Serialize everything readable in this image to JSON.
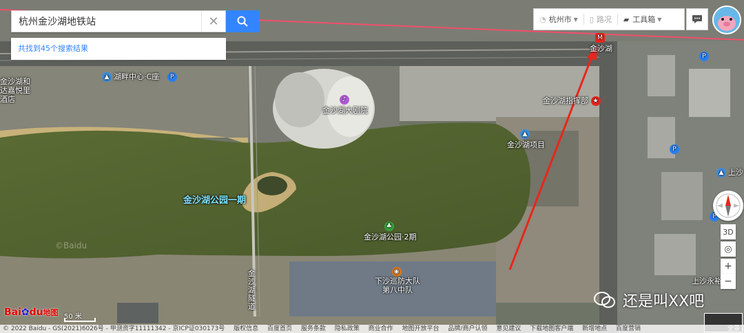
{
  "search": {
    "query": "杭州金沙湖地铁站",
    "result_prefix": "共找到",
    "result_count": "45",
    "result_suffix": "个搜索结果"
  },
  "toolbar": {
    "city": "杭州市",
    "traffic": "路况",
    "tools": "工具箱"
  },
  "controls": {
    "three_d": "3D",
    "zoom_in": "+",
    "zoom_out": "−",
    "panorama": "全景"
  },
  "pois": {
    "metro_station": "金沙湖",
    "theater": "金沙湖大剧院",
    "lakeside_center": "湖畔中心·C座",
    "hotel": "金沙湖和达嘉悦里酒店",
    "hq": "金沙湖指挥部",
    "project": "金沙湖项目",
    "park_phase1": "金沙湖公园一期",
    "park_phase2": "金沙湖公园·2期",
    "fire_brigade_line1": "下沙巡防大队",
    "fire_brigade_line2": "第八中队",
    "tunnel": "金沙湖隧道",
    "right_1": "上沙",
    "right_2": "上沙永裕",
    "road": "海",
    "top_partial": "建设路"
  },
  "map_meta": {
    "scale_label": "50 米",
    "baidu_watermark": "©Baidu",
    "logo_text_1": "Bai",
    "logo_text_2": "du",
    "logo_text_3": "地图"
  },
  "footer": {
    "items": [
      "© 2022 Baidu - GS(2021)6026号 - 甲测资字11111342 - 京ICP证030173号",
      "版权信息",
      "百度首页",
      "服务条款",
      "隐私政策",
      "商业合作",
      "地图开放平台",
      "品牌/商户认领",
      "意见建议",
      "下载地图客户端",
      "新增地点",
      "百度营销"
    ]
  },
  "watermark": {
    "text": "还是叫XX吧"
  },
  "colors": {
    "search_button": "#3385ff",
    "result_text": "#3385ff",
    "annotation_arrow": "#e8261d",
    "lake_label": "#7fe3ff"
  },
  "icons": [
    "search-icon",
    "close-icon",
    "message-icon",
    "compass-icon",
    "locate-icon",
    "parking-icon",
    "metro-icon",
    "star-icon"
  ]
}
